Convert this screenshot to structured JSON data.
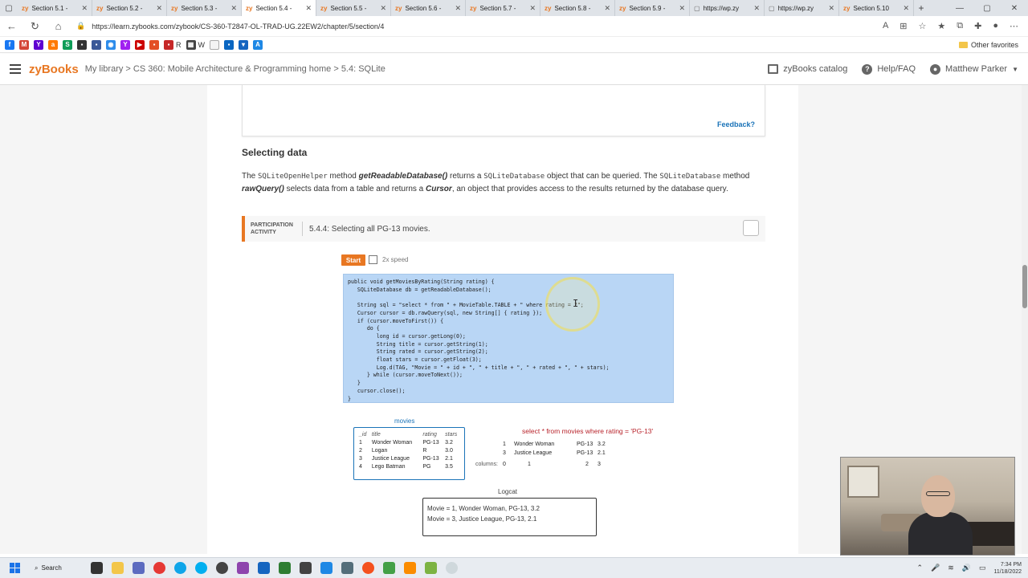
{
  "browser": {
    "tabs": [
      {
        "label": "Section 5.1 -",
        "type": "zy"
      },
      {
        "label": "Section 5.2 -",
        "type": "zy"
      },
      {
        "label": "Section 5.3 -",
        "type": "zy"
      },
      {
        "label": "Section 5.4 -",
        "type": "zy",
        "active": true
      },
      {
        "label": "Section 5.5 -",
        "type": "zy"
      },
      {
        "label": "Section 5.6 -",
        "type": "zy"
      },
      {
        "label": "Section 5.7 -",
        "type": "zy"
      },
      {
        "label": "Section 5.8 -",
        "type": "zy"
      },
      {
        "label": "Section 5.9 -",
        "type": "zy"
      },
      {
        "label": "https://wp.zy",
        "type": "page"
      },
      {
        "label": "https://wp.zy",
        "type": "page"
      },
      {
        "label": "Section 5.10",
        "type": "zy"
      }
    ],
    "url": "https://learn.zybooks.com/zybook/CS-360-T2847-OL-TRAD-UG.22EW2/chapter/5/section/4",
    "bookmarks_other": "Other favorites",
    "bookmark_letters": [
      "R",
      "W"
    ]
  },
  "header": {
    "logo": "zyBooks",
    "breadcrumb": "My library > CS 360: Mobile Architecture & Programming home > 5.4: SQLite",
    "catalog": "zyBooks catalog",
    "help": "Help/FAQ",
    "user": "Matthew Parker"
  },
  "prev_card": {
    "feedback": "Feedback?"
  },
  "section": {
    "title": "Selecting data",
    "p_1": "The ",
    "p_code1": "SQLiteOpenHelper",
    "p_2": " method ",
    "p_b1": "getReadableDatabase()",
    "p_3": " returns a ",
    "p_code2": "SQLiteDatabase",
    "p_4": " object that can be queried. The ",
    "p_code3": "SQLiteDatabase",
    "p_5": " method ",
    "p_b2": "rawQuery()",
    "p_6": " selects data from a table and returns a ",
    "p_b3": "Cursor",
    "p_7": ", an object that provides access to the results returned by the database query."
  },
  "activity": {
    "label_line1": "PARTICIPATION",
    "label_line2": "ACTIVITY",
    "title": "5.4.4: Selecting all PG-13 movies.",
    "start": "Start",
    "speed": "2x speed",
    "code": "public void getMoviesByRating(String rating) {\n   SQLiteDatabase db = getReadableDatabase();\n\n   String sql = \"select * from \" + MovieTable.TABLE + \" where rating = ?\";\n   Cursor cursor = db.rawQuery(sql, new String[] { rating });\n   if (cursor.moveToFirst()) {\n      do {\n         long id = cursor.getLong(0);\n         String title = cursor.getString(1);\n         String rated = cursor.getString(2);\n         float stars = cursor.getFloat(3);\n         Log.d(TAG, \"Movie = \" + id + \", \" + title + \", \" + rated + \", \" + stars);\n      } while (cursor.moveToNext());\n   }\n   cursor.close();\n}",
    "movies_label": "movies",
    "movies_headers": [
      "_id",
      "title",
      "rating",
      "stars"
    ],
    "movies_rows": [
      [
        "1",
        "Wonder Woman",
        "PG-13",
        "3.2"
      ],
      [
        "2",
        "Logan",
        "R",
        "3.0"
      ],
      [
        "3",
        "Justice League",
        "PG-13",
        "2.1"
      ],
      [
        "4",
        "Lego Batman",
        "PG",
        "3.5"
      ]
    ],
    "query": "select * from movies where rating = 'PG-13'",
    "result_rows": [
      [
        "1",
        "Wonder Woman",
        "PG-13",
        "3.2"
      ],
      [
        "3",
        "Justice League",
        "PG-13",
        "2.1"
      ]
    ],
    "columns_label": "columns:",
    "columns": [
      "0",
      "1",
      "2",
      "3"
    ],
    "logcat_label": "Logcat",
    "logcat_lines": [
      "Movie = 1, Wonder Woman, PG-13, 3.2",
      "Movie = 3, Justice League, PG-13, 2.1"
    ]
  },
  "taskbar": {
    "search": "Search",
    "time": "7:34 PM",
    "date": "11/18/2022"
  },
  "colors": {
    "accent": "#e87722",
    "link": "#1a73b8",
    "code_bg": "#b9d6f5",
    "query": "#b8242c"
  }
}
